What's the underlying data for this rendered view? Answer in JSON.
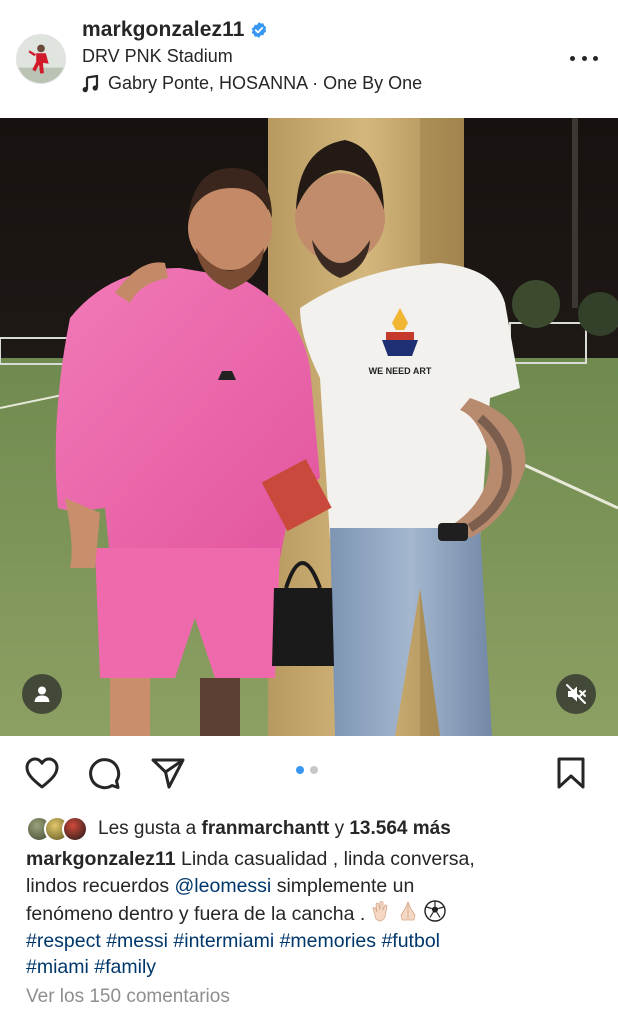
{
  "header": {
    "username": "markgonzalez11",
    "location": "DRV PNK Stadium",
    "music": "Gabry Ponte, HOSANNA · One By One"
  },
  "photo": {
    "shirt_text": "WE NEED ART",
    "carousel": {
      "current": 1,
      "total": 2
    }
  },
  "likes": {
    "prefix": "Les gusta a",
    "user": "franmarchantt",
    "joiner": "y",
    "count": "13.564 más"
  },
  "caption": {
    "author": "markgonzalez11",
    "line1_text": "Linda casualidad , linda conversa,",
    "line2_pre": "lindos recuerdos",
    "mention": "@leomessi",
    "line2_post": "simplemente un",
    "line3_text": "fenómeno dentro y fuera de la cancha .",
    "hashtags_line1": "#respect #messi #intermiami #memories #futbol",
    "hashtags_line2": "#miami #family"
  },
  "comments_link": "Ver los 150 comentarios",
  "colors": {
    "text": "#262626",
    "link": "#00376b",
    "muted": "#8e8e8e",
    "verified": "#3897f0",
    "dot_active": "#3897f0",
    "dot_inactive": "#c7c7c7"
  },
  "icons": [
    "verified-icon",
    "music-note-icon",
    "more-icon",
    "person-tag-icon",
    "mute-icon",
    "heart-icon",
    "comment-icon",
    "share-icon",
    "bookmark-icon"
  ]
}
